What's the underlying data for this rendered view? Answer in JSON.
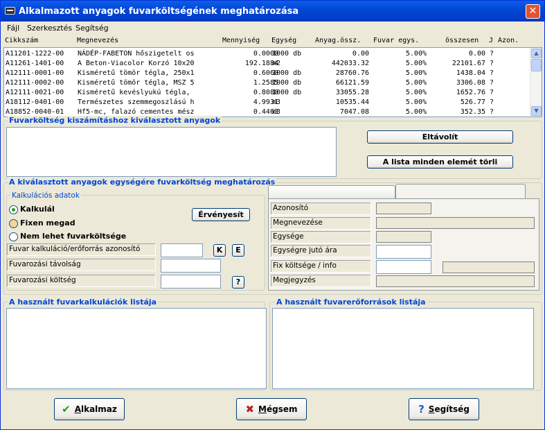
{
  "window": {
    "title": "Alkalmazott anyagok fuvarköltségének meghatározása",
    "close": "✕"
  },
  "menu": [
    "Fájl",
    "Szerkesztés",
    "Segítség"
  ],
  "grid": {
    "headers": [
      "Cikkszám",
      "Megnevezés",
      "Mennyiség",
      "Egység",
      "Anyag.össz.",
      "Fuvar egys.",
      "összesen",
      "J",
      "Azon."
    ],
    "rows": [
      [
        "A11201-1222-00",
        "NÁDÉP-FABETON hőszigetelt os",
        "0.0000",
        "1000 db",
        "0.00",
        "5.00%",
        "0.00",
        "?"
      ],
      [
        "A11261-1401-00",
        "A Beton-Viacolor Korzó 10x20",
        "192.1884",
        "m2",
        "442033.32",
        "5.00%",
        "22101.67",
        "?"
      ],
      [
        "A12111-0001-00",
        "Kisméretű tömör tégla, 250x1",
        "0.6060",
        "1000 db",
        "28760.76",
        "5.00%",
        "1438.04",
        "?"
      ],
      [
        "A12111-0002-00",
        "Kisméretű tömör tégla, MSZ 5",
        "1.2585",
        "1000 db",
        "66121.59",
        "5.00%",
        "3306.08",
        "?"
      ],
      [
        "A12111-0021-00",
        "Kisméretű kevéslyukú tégla,",
        "0.8080",
        "1000 db",
        "33055.28",
        "5.00%",
        "1652.76",
        "?"
      ],
      [
        "A18112-0401-00",
        "Természetes szemmegoszlású h",
        "4.9931",
        "m3",
        "10535.44",
        "5.00%",
        "526.77",
        "?"
      ],
      [
        "A18852-0040-01",
        "Hf5-mc, falazó cementes mész",
        "0.4463",
        "m3",
        "7047.08",
        "5.00%",
        "352.35",
        "?"
      ]
    ]
  },
  "selected_section": {
    "title": "Fuvarköltség kiszámításhoz kiválasztott anyagok",
    "remove": "Eltávolít",
    "clear_all": "A lista minden elemét törli"
  },
  "unit_section": {
    "title": "A kiválasztott anyagok egységére fuvarköltség meghatározás"
  },
  "calc": {
    "group_title": "Kalkulációs adatok",
    "radio_options": [
      "Kalkulál",
      "Fixen megad",
      "Nem lehet fuvarköltsége"
    ],
    "validate": "Érvényesít",
    "labels": [
      "Fuvar kalkuláció/erőforrás azonosító",
      "Fuvarozási távolság",
      "Fuvarozási költség"
    ],
    "k_btn": "K",
    "e_btn": "E",
    "help_btn": "?"
  },
  "details": {
    "labels": [
      "Azonosító",
      "Megnevezése",
      "Egysége",
      "Egységre jutó ára",
      "Fix költsége / info",
      "Megjegyzés"
    ]
  },
  "lists": {
    "calc_list": "A használt fuvarkalkulációk listája",
    "resource_list": "A használt fuvarerőforrások listája"
  },
  "buttons": {
    "apply_first": "A",
    "apply_rest": "lkalmaz",
    "cancel_first": "M",
    "cancel_rest": "égsem",
    "help_first": "S",
    "help_rest": "egítség"
  },
  "colors": {
    "title_bar": "#0548d6",
    "section_title": "#0046d5",
    "close": "#e2532e"
  }
}
